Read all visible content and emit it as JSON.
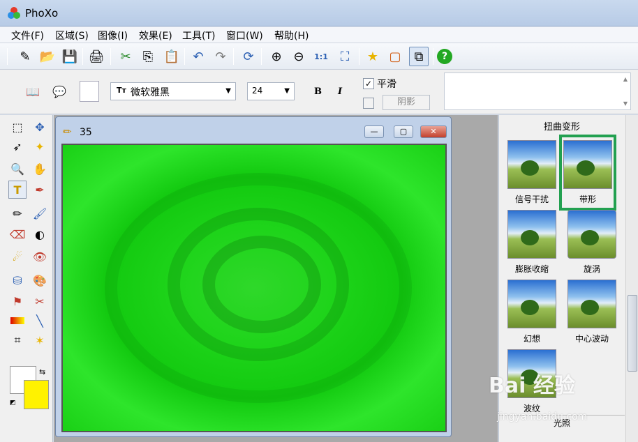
{
  "app": {
    "title": "PhoXo"
  },
  "menu": [
    "文件(F)",
    "区域(S)",
    "图像(I)",
    "效果(E)",
    "工具(T)",
    "窗口(W)",
    "帮助(H)"
  ],
  "textbar": {
    "font": "微软雅黑",
    "size": "24",
    "bold": "B",
    "italic": "I",
    "smooth_label": "平滑",
    "smooth_checked": "✓",
    "shadow_label": "阴影"
  },
  "image_window": {
    "title": "35",
    "min": "—",
    "max": "▢",
    "close": "✕"
  },
  "effects_panel": {
    "header": "扭曲变形",
    "items": [
      "信号干扰",
      "带形",
      "膨胀收缩",
      "旋涡",
      "幻想",
      "中心波动",
      "波纹"
    ],
    "footer": "光照",
    "selected": "带形"
  },
  "watermark": {
    "main": "Bai 经验",
    "sub": "jingyan.baidu.com"
  },
  "colors": {
    "foreground": "#ffffff",
    "background": "#fff200",
    "canvas": "#1ed41a",
    "selected_border": "#22a050"
  }
}
